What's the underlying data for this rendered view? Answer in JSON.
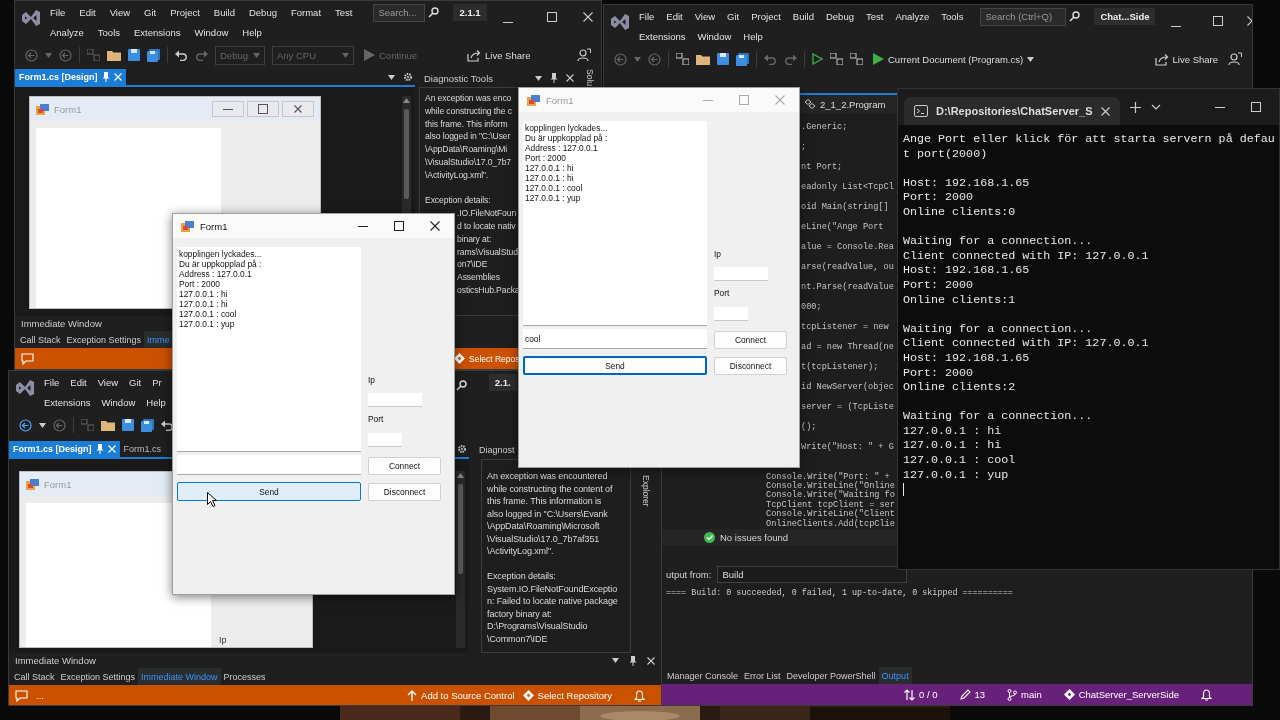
{
  "vs_form_designer": {
    "menu": [
      [
        "File",
        "Edit",
        "View",
        "Git",
        "Project",
        "Build",
        "Debug",
        "Format",
        "Test"
      ],
      [
        "Analyze",
        "Tools",
        "Extensions",
        "Window",
        "Help"
      ]
    ],
    "search": {
      "placeholder": "Search..."
    },
    "solution": "2.1.1",
    "toolbar": {
      "configuration": {
        "label": "Debug",
        "disabled": true
      },
      "platform": {
        "label": "Any CPU",
        "disabled": true
      },
      "continue": {
        "label": "Continue",
        "disabled": true
      },
      "live_share": "Live Share"
    },
    "tabs": [
      {
        "label": "Form1.cs [Design]",
        "selected": true
      }
    ],
    "designer_form_title": "Form1",
    "diagnostic_tools": {
      "title": "Diagnostic Tools",
      "lines": [
        "An exception was enco",
        "while constructing the c",
        "this frame.  This inform",
        "also logged in \"C:\\User",
        "\\AppData\\Roaming\\Mi",
        "\\VisualStudio\\17.0_7b7",
        "\\ActivityLog.xml\"."
      ],
      "details_heading": "Exception details:",
      "details_lines": [
        ".IO.FileNotFoun",
        "d to locate nativ",
        "binary at:",
        "rams\\VisualStud",
        "on7\\IDE",
        "Assemblies",
        "osticsHub.Packa"
      ]
    },
    "side_tab": "Solu",
    "tool_window_title": "Immediate Window",
    "bottom_tabs": [
      {
        "label": "Call Stack",
        "selected": false
      },
      {
        "label": "Exception Settings",
        "selected": false
      },
      {
        "label": "Imme",
        "selected": true
      }
    ],
    "status_bar": {
      "repository": "Select Repos"
    }
  },
  "vs_server": {
    "menu": [
      [
        "File",
        "Edit",
        "View",
        "Git",
        "Project",
        "Build",
        "Debug",
        "Test",
        "Analyze",
        "Tools"
      ],
      [
        "Extensions",
        "Window",
        "Help"
      ]
    ],
    "search": {
      "placeholder": "Search (Ctrl+Q)"
    },
    "solution": "Chat...Side",
    "toolbar": {
      "start": "Current Document (Program.cs)",
      "live_share": "Live Share"
    },
    "navigation": "2_1_2.Program",
    "code_upper": [
      ".Generic;",
      ";",
      "nt Port;",
      "eadonly List<TcpCl",
      "oid Main(string[]",
      "eLine(\"Ange Port",
      "alue = Console.Rea",
      "arse(readValue, ou",
      "nt.Parse(readValue",
      "000;",
      "tcpListener = new",
      "ad = new Thread(ne",
      "t(tcpListener);",
      "id NewServer(objec",
      "server = (TcpListe",
      "();",
      "Write(\"Host: \" + G"
    ],
    "code_lower": [
      "Console.Write(\"Port: \" +",
      "Console.WriteLine(\"Online",
      "Console.Write(\"Waiting fo",
      "TcpClient tcpClient = ser",
      "Console.WriteLine(\"Client",
      "OnlineClients.Add(tcpClie"
    ],
    "issues": "No issues found",
    "output": {
      "label": "utput from:",
      "source": "Build",
      "lines": [
        "==== Build: 0 succeeded, 0 failed, 1 up-to-date, 0 skipped =========="
      ]
    },
    "bottom_tabs": [
      {
        "label": "Manager Console",
        "selected": false
      },
      {
        "label": "Error List",
        "selected": false
      },
      {
        "label": "Developer PowerShell",
        "selected": false
      },
      {
        "label": "Output",
        "selected": true
      }
    ],
    "status_bar": {
      "changes": "0 / 0",
      "edits": "13",
      "branch": "main",
      "repository": "ChatServer_ServerSide"
    }
  },
  "vs_client": {
    "menu": [
      [
        "File",
        "Edit",
        "View",
        "Git",
        "Pr"
      ],
      [
        "Extensions",
        "Window",
        "Help"
      ]
    ],
    "solution": "2.1.",
    "tabs": [
      {
        "label": "Form1.cs [Design]",
        "selected": true
      },
      {
        "label": "Form1.cs",
        "selected": false
      }
    ],
    "designer_form": {
      "title": "Form1",
      "label": "Ip"
    },
    "diagnostic_tools": {
      "title": "Diagnost",
      "lines": [
        "An exception was encountered",
        "while constructing the content of",
        "this frame.  This information is",
        "also logged in \"C:\\Users\\Evank",
        "\\AppData\\Roaming\\Microsoft",
        "\\VisualStudio\\17.0_7b7af351",
        "\\ActivityLog.xml\"."
      ],
      "details_lines": [
        "Exception details:",
        "System.IO.FileNotFoundExceptio",
        "n: Failed to locate native package",
        "factory binary at:",
        "D:\\Programs\\VisualStudio",
        "\\Common7\\IDE"
      ]
    },
    "side_tab": "Explorer",
    "tool_window_title": "Immediate Window",
    "bottom_tabs": [
      {
        "label": "Call Stack",
        "selected": false
      },
      {
        "label": "Exception Settings",
        "selected": false
      },
      {
        "label": "Immediate Window",
        "selected": true
      },
      {
        "label": "Processes",
        "selected": false
      }
    ],
    "status_bar": {
      "message": "...",
      "source_control": "Add to Source Control",
      "repository": "Select Repository"
    }
  },
  "terminal": {
    "tab": {
      "title": "D:\\Repositories\\ChatServer_S",
      "selected": true
    },
    "blocks": [
      [
        "Ange Port eller klick för att starta servern på defau",
        "t port(2000)"
      ],
      [
        "Host: 192.168.1.65",
        "Port: 2000",
        "Online clients:0"
      ],
      [
        "Waiting for a connection...",
        "Client connected with IP: 127.0.0.1",
        "Host: 192.168.1.65",
        "Port: 2000",
        "Online clients:1"
      ],
      [
        "Waiting for a connection...",
        "Client connected with IP: 127.0.0.1",
        "Host: 192.168.1.65",
        "Port: 2000",
        "Online clients:2"
      ],
      [
        "Waiting for a connection...",
        "127.0.0.1 : hi",
        "127.0.0.1 : hi",
        "127.0.0.1 : cool",
        "127.0.0.1 : yup"
      ]
    ]
  },
  "client_forms": [
    {
      "title": "Form1",
      "active": false,
      "messages": [
        "kopplingen lyckades...",
        "Du är uppkopplad på :",
        "Address : 127.0.0.1",
        "Port : 2000",
        "127.0.0.1 : hi",
        "127.0.0.1 : hi",
        "127.0.0.1 : cool",
        "127.0.0.1 : yup"
      ],
      "message_input": {
        "value": "cool"
      },
      "send": {
        "label": "Send",
        "focused": true,
        "hovered": false
      },
      "ip_label": "Ip",
      "port_label": "Port",
      "connect": "Connect",
      "disconnect": "Disconnect"
    },
    {
      "title": "Form1",
      "active": true,
      "messages": [
        "kopplingen lyckades...",
        "Du är uppkopplad på :",
        "Address : 127.0.0.1",
        "Port : 2000",
        "127.0.0.1 : hi",
        "127.0.0.1 : hi",
        "127.0.0.1 : cool",
        "127.0.0.1 : yup"
      ],
      "send": {
        "label": "Send",
        "focused": false,
        "hovered": true
      },
      "ip_label": "Ip",
      "port_label": "Port",
      "connect": "Connect",
      "disconnect": "Disconnect"
    }
  ]
}
